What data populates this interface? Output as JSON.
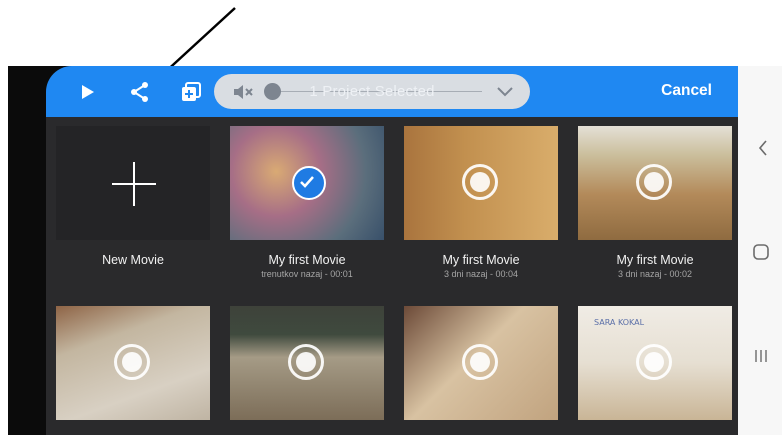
{
  "toolbar": {
    "play_icon": "play-icon",
    "share_icon": "share-icon",
    "add_copy_icon": "add-copy-icon",
    "mute_icon": "mute-icon",
    "selection_title": "1 Project Selected",
    "chevron_icon": "chevron-down-icon",
    "cancel_label": "Cancel",
    "accent_color": "#1f88f2"
  },
  "annotation": {
    "arrow": "pointer-arrow-to-share"
  },
  "new_movie": {
    "label": "New Movie"
  },
  "projects": [
    {
      "title": "My first Movie",
      "subtitle": "trenutkov nazaj - 00:01",
      "selected": true
    },
    {
      "title": "My first Movie",
      "subtitle": "3 dni nazaj - 00:04",
      "selected": false
    },
    {
      "title": "My first Movie",
      "subtitle": "3 dni nazaj - 00:02",
      "selected": false
    }
  ],
  "row2_thumbnails": [
    {
      "selected": false
    },
    {
      "selected": false
    },
    {
      "selected": false
    },
    {
      "selected": false,
      "note_text": "SARA KOKAL"
    }
  ],
  "system_nav": {
    "back_icon": "back-chevron-icon",
    "home_icon": "home-square-icon",
    "recents_icon": "recents-icon"
  }
}
